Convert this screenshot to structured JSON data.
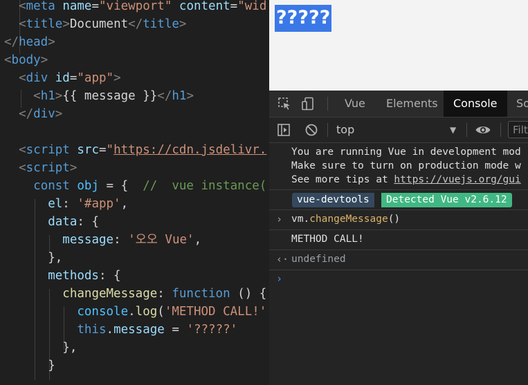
{
  "editor": {
    "lines": [
      [
        {
          "t": "  ",
          "c": "t-text"
        },
        {
          "t": "<",
          "c": "t-punct"
        },
        {
          "t": "meta",
          "c": "t-tag"
        },
        {
          "t": " name",
          "c": "t-attr"
        },
        {
          "t": "=",
          "c": "t-text"
        },
        {
          "t": "\"viewport\"",
          "c": "t-str"
        },
        {
          "t": " content",
          "c": "t-attr"
        },
        {
          "t": "=",
          "c": "t-text"
        },
        {
          "t": "\"wid",
          "c": "t-str"
        }
      ],
      [
        {
          "t": "  ",
          "c": "t-text"
        },
        {
          "t": "<",
          "c": "t-punct"
        },
        {
          "t": "title",
          "c": "t-tag"
        },
        {
          "t": ">",
          "c": "t-punct"
        },
        {
          "t": "Document",
          "c": "t-text"
        },
        {
          "t": "</",
          "c": "t-punct"
        },
        {
          "t": "title",
          "c": "t-tag"
        },
        {
          "t": ">",
          "c": "t-punct"
        }
      ],
      [
        {
          "t": "</",
          "c": "t-punct"
        },
        {
          "t": "head",
          "c": "t-tag"
        },
        {
          "t": ">",
          "c": "t-punct"
        }
      ],
      [
        {
          "t": "<",
          "c": "t-punct"
        },
        {
          "t": "body",
          "c": "t-tag"
        },
        {
          "t": ">",
          "c": "t-punct"
        }
      ],
      [
        {
          "t": "  ",
          "c": "t-text"
        },
        {
          "t": "<",
          "c": "t-punct"
        },
        {
          "t": "div",
          "c": "t-tag"
        },
        {
          "t": " id",
          "c": "t-attr"
        },
        {
          "t": "=",
          "c": "t-text"
        },
        {
          "t": "\"app\"",
          "c": "t-str"
        },
        {
          "t": ">",
          "c": "t-punct"
        }
      ],
      [
        {
          "t": "    ",
          "c": "t-text"
        },
        {
          "t": "<",
          "c": "t-punct"
        },
        {
          "t": "h1",
          "c": "t-tag"
        },
        {
          "t": ">",
          "c": "t-punct"
        },
        {
          "t": "{{ message }}",
          "c": "t-text"
        },
        {
          "t": "</",
          "c": "t-punct"
        },
        {
          "t": "h1",
          "c": "t-tag"
        },
        {
          "t": ">",
          "c": "t-punct"
        }
      ],
      [
        {
          "t": "  ",
          "c": "t-text"
        },
        {
          "t": "</",
          "c": "t-punct"
        },
        {
          "t": "div",
          "c": "t-tag"
        },
        {
          "t": ">",
          "c": "t-punct"
        }
      ],
      [],
      [
        {
          "t": "  ",
          "c": "t-text"
        },
        {
          "t": "<",
          "c": "t-punct"
        },
        {
          "t": "script",
          "c": "t-tag"
        },
        {
          "t": " src",
          "c": "t-attr"
        },
        {
          "t": "=",
          "c": "t-text"
        },
        {
          "t": "\"",
          "c": "t-str"
        },
        {
          "t": "https://cdn.jsdelivr.",
          "c": "t-link"
        }
      ],
      [
        {
          "t": "  ",
          "c": "t-text"
        },
        {
          "t": "<",
          "c": "t-punct"
        },
        {
          "t": "script",
          "c": "t-tag"
        },
        {
          "t": ">",
          "c": "t-punct"
        }
      ],
      [
        {
          "t": "    ",
          "c": "t-text"
        },
        {
          "t": "const",
          "c": "t-kw"
        },
        {
          "t": " obj",
          "c": "t-var"
        },
        {
          "t": " = {  ",
          "c": "t-text"
        },
        {
          "t": "//  vue instance(",
          "c": "t-cmt"
        }
      ],
      [
        {
          "t": "      ",
          "c": "t-text"
        },
        {
          "t": "el",
          "c": "t-prop"
        },
        {
          "t": ": ",
          "c": "t-text"
        },
        {
          "t": "'#app'",
          "c": "t-str"
        },
        {
          "t": ",",
          "c": "t-text"
        }
      ],
      [
        {
          "t": "      ",
          "c": "t-text"
        },
        {
          "t": "data",
          "c": "t-prop"
        },
        {
          "t": ": {",
          "c": "t-text"
        }
      ],
      [
        {
          "t": "        ",
          "c": "t-text"
        },
        {
          "t": "message",
          "c": "t-prop"
        },
        {
          "t": ": ",
          "c": "t-text"
        },
        {
          "t": "'오오 Vue'",
          "c": "t-str"
        },
        {
          "t": ",",
          "c": "t-text"
        }
      ],
      [
        {
          "t": "      },",
          "c": "t-text"
        }
      ],
      [
        {
          "t": "      ",
          "c": "t-text"
        },
        {
          "t": "methods",
          "c": "t-prop"
        },
        {
          "t": ": {",
          "c": "t-text"
        }
      ],
      [
        {
          "t": "        ",
          "c": "t-text"
        },
        {
          "t": "changeMessage",
          "c": "t-fn"
        },
        {
          "t": ": ",
          "c": "t-text"
        },
        {
          "t": "function",
          "c": "t-kw"
        },
        {
          "t": " () {",
          "c": "t-text"
        }
      ],
      [
        {
          "t": "          ",
          "c": "t-text"
        },
        {
          "t": "console",
          "c": "t-var"
        },
        {
          "t": ".",
          "c": "t-text"
        },
        {
          "t": "log",
          "c": "t-fn"
        },
        {
          "t": "(",
          "c": "t-text"
        },
        {
          "t": "'METHOD CALL!'",
          "c": "t-str"
        }
      ],
      [
        {
          "t": "          ",
          "c": "t-text"
        },
        {
          "t": "this",
          "c": "t-kw"
        },
        {
          "t": ".",
          "c": "t-text"
        },
        {
          "t": "message",
          "c": "t-prop"
        },
        {
          "t": " = ",
          "c": "t-text"
        },
        {
          "t": "'?????'",
          "c": "t-str"
        }
      ],
      [
        {
          "t": "        },",
          "c": "t-text"
        }
      ],
      [
        {
          "t": "      }",
          "c": "t-text"
        }
      ]
    ]
  },
  "viewport": {
    "h1_text": "?????"
  },
  "devtools": {
    "tabs": {
      "vue": "Vue",
      "elements": "Elements",
      "console": "Console",
      "sources": "So"
    },
    "toolbar": {
      "context": "top",
      "filter_placeholder": "Filte"
    },
    "console": {
      "dev_mode_lines": [
        "You are running Vue in development mod",
        "Make sure to turn on production mode w"
      ],
      "tips_prefix": "See more tips at ",
      "tips_link": "https://vuejs.org/gui",
      "badge_devtools": "vue-devtools",
      "badge_detected": "Detected Vue v2.6.12",
      "input_obj": "vm.",
      "input_method": "changeMessage",
      "input_parens": "()",
      "log_output": "METHOD CALL!",
      "return_value": "undefined"
    },
    "colors": {
      "vue_green": "#41b883",
      "vue_dark": "#35495e",
      "selection_blue": "#3b78e7"
    }
  }
}
